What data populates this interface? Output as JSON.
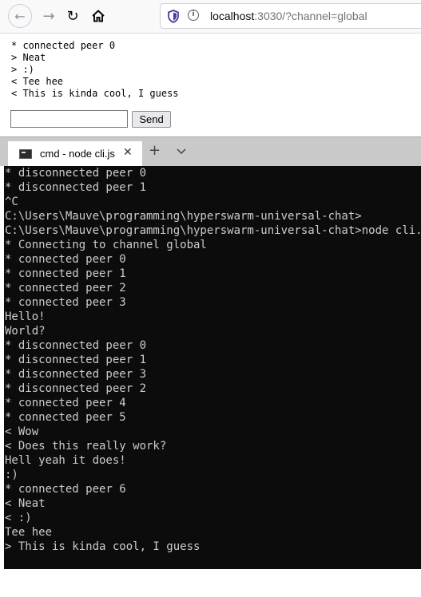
{
  "browser": {
    "url_host": "localhost",
    "url_rest": ":3030/?channel=global",
    "icons": {
      "back": "back-arrow-icon",
      "forward": "forward-arrow-icon",
      "reload": "reload-icon",
      "home": "home-icon",
      "shield": "tracking-protection-shield-icon",
      "info": "site-info-icon"
    }
  },
  "chat": {
    "messages": [
      "* connected peer 0",
      "> Neat",
      "> :)",
      "< Tee hee",
      "< This is kinda cool, I guess"
    ],
    "input_value": "",
    "send_label": "Send"
  },
  "terminal": {
    "tab_title": "cmd - node  cli.js",
    "tab_close": "✕",
    "new_tab": "+",
    "lines": [
      "* disconnected peer 0",
      "* disconnected peer 1",
      "^C",
      "C:\\Users\\Mauve\\programming\\hyperswarm-universal-chat>",
      "C:\\Users\\Mauve\\programming\\hyperswarm-universal-chat>node cli.js",
      "* Connecting to channel global",
      "* connected peer 0",
      "* connected peer 1",
      "* connected peer 2",
      "* connected peer 3",
      "Hello!",
      "World?",
      "* disconnected peer 0",
      "* disconnected peer 1",
      "* disconnected peer 3",
      "* disconnected peer 2",
      "* connected peer 4",
      "* connected peer 5",
      "< Wow",
      "< Does this really work?",
      "Hell yeah it does!",
      ":)",
      "* connected peer 6",
      "< Neat",
      "< :)",
      "Tee hee",
      "> This is kinda cool, I guess"
    ]
  }
}
